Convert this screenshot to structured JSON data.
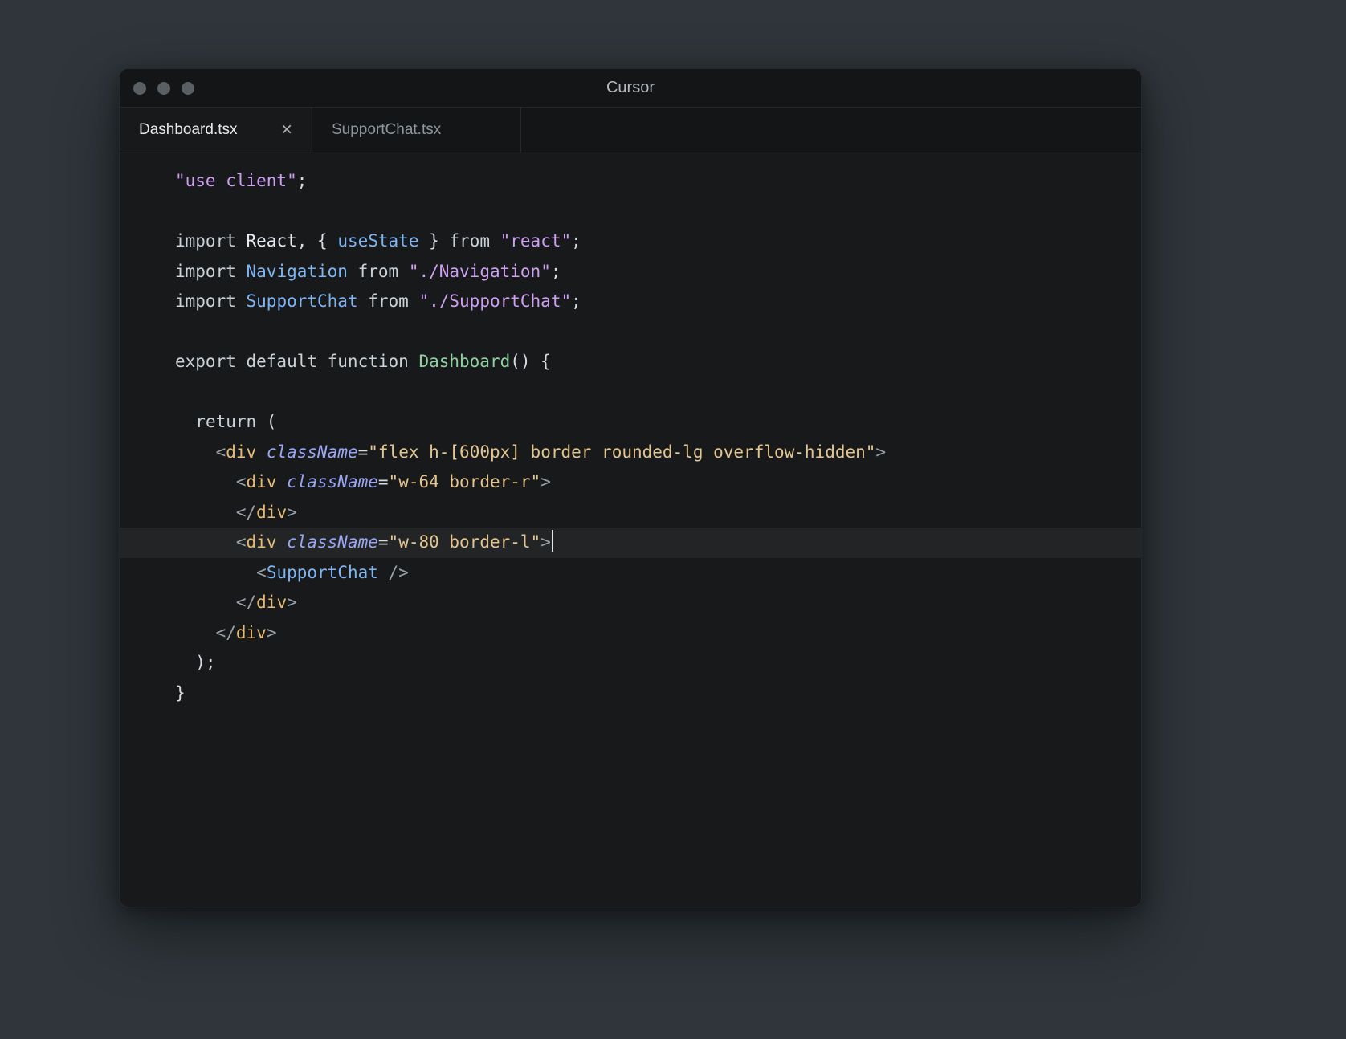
{
  "window": {
    "title": "Cursor"
  },
  "tab_bar": {
    "tabs": [
      {
        "label": "Dashboard.tsx",
        "active": true,
        "close_glyph": "×"
      },
      {
        "label": "SupportChat.tsx",
        "active": false
      }
    ]
  },
  "editor": {
    "current_line": 12,
    "caret_line": 12,
    "lines": [
      {
        "tokens": [
          {
            "t": "\"use client\"",
            "s": "str"
          },
          {
            "t": ";",
            "s": "base"
          }
        ]
      },
      {
        "tokens": []
      },
      {
        "tokens": [
          {
            "t": "import ",
            "s": "kw"
          },
          {
            "t": "React",
            "s": "ident"
          },
          {
            "t": ", { ",
            "s": "base"
          },
          {
            "t": "useState",
            "s": "comp"
          },
          {
            "t": " } ",
            "s": "base"
          },
          {
            "t": "from ",
            "s": "kw"
          },
          {
            "t": "\"react\"",
            "s": "str"
          },
          {
            "t": ";",
            "s": "base"
          }
        ]
      },
      {
        "tokens": [
          {
            "t": "import ",
            "s": "kw"
          },
          {
            "t": "Navigation",
            "s": "comp"
          },
          {
            "t": " ",
            "s": "base"
          },
          {
            "t": "from ",
            "s": "kw"
          },
          {
            "t": "\"./Navigation\"",
            "s": "str"
          },
          {
            "t": ";",
            "s": "base"
          }
        ]
      },
      {
        "tokens": [
          {
            "t": "import ",
            "s": "kw"
          },
          {
            "t": "SupportChat",
            "s": "comp"
          },
          {
            "t": " ",
            "s": "base"
          },
          {
            "t": "from ",
            "s": "kw"
          },
          {
            "t": "\"./SupportChat\"",
            "s": "str"
          },
          {
            "t": ";",
            "s": "base"
          }
        ]
      },
      {
        "tokens": []
      },
      {
        "tokens": [
          {
            "t": "export default function ",
            "s": "kw"
          },
          {
            "t": "Dashboard",
            "s": "fn"
          },
          {
            "t": "() {",
            "s": "base"
          }
        ]
      },
      {
        "tokens": []
      },
      {
        "tokens": [
          {
            "t": "  ",
            "s": "base"
          },
          {
            "t": "return",
            "s": "kw"
          },
          {
            "t": " (",
            "s": "base"
          }
        ]
      },
      {
        "tokens": [
          {
            "t": "    ",
            "s": "base"
          },
          {
            "t": "<",
            "s": "punct"
          },
          {
            "t": "div ",
            "s": "tag"
          },
          {
            "t": "className",
            "s": "attr",
            "i": true
          },
          {
            "t": "=",
            "s": "base"
          },
          {
            "t": "\"flex h-[600px] border rounded-lg overflow-hidden\"",
            "s": "attrstr"
          },
          {
            "t": ">",
            "s": "punct"
          }
        ]
      },
      {
        "tokens": [
          {
            "t": "      ",
            "s": "base"
          },
          {
            "t": "<",
            "s": "punct"
          },
          {
            "t": "div ",
            "s": "tag"
          },
          {
            "t": "className",
            "s": "attr",
            "i": true
          },
          {
            "t": "=",
            "s": "base"
          },
          {
            "t": "\"w-64 border-r\"",
            "s": "attrstr"
          },
          {
            "t": ">",
            "s": "punct"
          }
        ]
      },
      {
        "tokens": [
          {
            "t": "      ",
            "s": "base"
          },
          {
            "t": "</",
            "s": "punct"
          },
          {
            "t": "div",
            "s": "tag"
          },
          {
            "t": ">",
            "s": "punct"
          }
        ]
      },
      {
        "tokens": [
          {
            "t": "      ",
            "s": "base"
          },
          {
            "t": "<",
            "s": "punct"
          },
          {
            "t": "div ",
            "s": "tag"
          },
          {
            "t": "className",
            "s": "attr",
            "i": true
          },
          {
            "t": "=",
            "s": "base"
          },
          {
            "t": "\"w-80 border-l\"",
            "s": "attrstr"
          },
          {
            "t": ">",
            "s": "punct"
          }
        ]
      },
      {
        "tokens": [
          {
            "t": "        ",
            "s": "base"
          },
          {
            "t": "<",
            "s": "punct"
          },
          {
            "t": "SupportChat",
            "s": "comp"
          },
          {
            "t": " />",
            "s": "punct"
          }
        ]
      },
      {
        "tokens": [
          {
            "t": "      ",
            "s": "base"
          },
          {
            "t": "</",
            "s": "punct"
          },
          {
            "t": "div",
            "s": "tag"
          },
          {
            "t": ">",
            "s": "punct"
          }
        ]
      },
      {
        "tokens": [
          {
            "t": "    ",
            "s": "base"
          },
          {
            "t": "</",
            "s": "punct"
          },
          {
            "t": "div",
            "s": "tag"
          },
          {
            "t": ">",
            "s": "punct"
          }
        ]
      },
      {
        "tokens": [
          {
            "t": "  );",
            "s": "base"
          }
        ]
      },
      {
        "tokens": [
          {
            "t": "}",
            "s": "base"
          }
        ]
      }
    ]
  },
  "colors": {
    "theme": {
      "page-bg": "#2f353a",
      "window-bg": "#17191b",
      "bar-bg": "#131517",
      "border": "#26292c",
      "title-fg": "#b6babd",
      "tab-active-fg": "#e6e8ea",
      "tab-inactive-fg": "#8f969c",
      "dot": "#5a5f63",
      "current-line": "rgba(255,255,255,0.05)",
      "caret": "#e2e5e8"
    },
    "syntax": {
      "base": "#d7dbdf",
      "kw": "#cbd1d6",
      "ident": "#e9ecef",
      "str": "#cf9ff2",
      "attrstr": "#e4c590",
      "tag": "#e7bb72",
      "attr": "#9aa5f4",
      "punct": "#9aa1a8",
      "comp": "#7fb5f2",
      "fn": "#8fd0a0"
    }
  }
}
